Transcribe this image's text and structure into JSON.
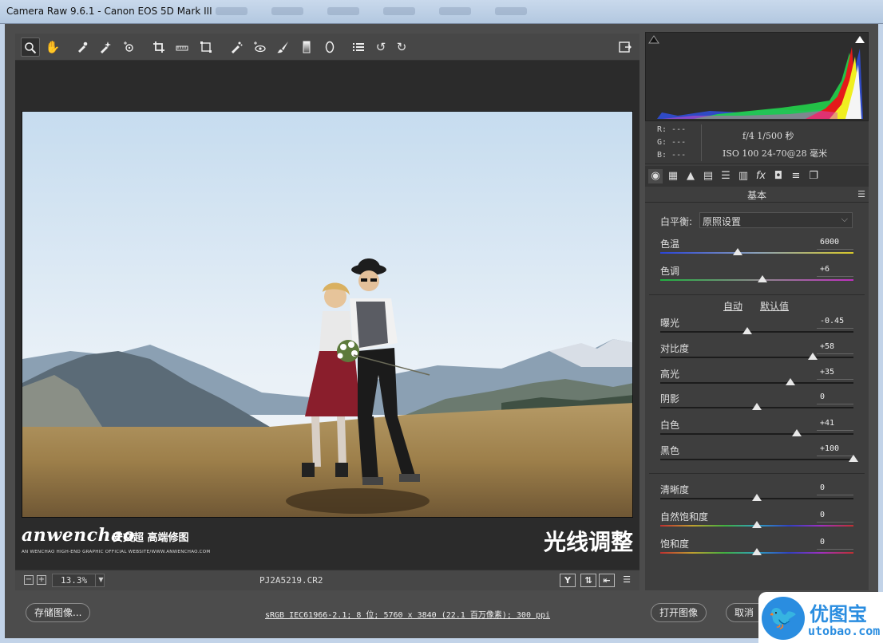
{
  "window": {
    "title": "Camera Raw 9.6.1 -  Canon EOS 5D Mark III"
  },
  "toolbar": {
    "tools": [
      "zoom-icon",
      "hand-icon",
      "white-balance-icon",
      "color-sampler-icon",
      "target-adjust-icon",
      "crop-icon",
      "straighten-icon",
      "transform-icon",
      "spot-removal-icon",
      "red-eye-icon",
      "adjustment-brush-icon",
      "graduated-filter-icon",
      "radial-filter-icon",
      "presets-list-icon",
      "rotate-left-icon",
      "rotate-right-icon"
    ],
    "active_tool": "zoom-icon"
  },
  "canvas": {
    "watermark_logo": "anwenchao",
    "watermark_cn": "安文超 高端修图",
    "watermark_sub": "AN WENCHAO HIGH-END GRAPHIC OFFICIAL WEBSITE/WWW.ANWENCHAO.COM",
    "overlay_title": "光线调整"
  },
  "status": {
    "zoom": "13.3%",
    "filename": "PJ2A5219.CR2",
    "view_icon_label": "Y"
  },
  "readout": {
    "r": "R:  ---",
    "g": "G:  ---",
    "b": "B:  ---",
    "line1": "f/4   1/500 秒",
    "line2": "ISO 100   24-70@28 毫米"
  },
  "panel": {
    "section_title": "基本",
    "white_balance_label": "白平衡:",
    "white_balance_value": "原照设置",
    "auto_label": "自动",
    "default_label": "默认值",
    "sliders": [
      {
        "label": "色温",
        "value": "6000",
        "pos": 0.4,
        "track": "temp"
      },
      {
        "label": "色调",
        "value": "+6",
        "pos": 0.53,
        "track": "tint"
      },
      {
        "label": "曝光",
        "value": "-0.45",
        "pos": 0.45,
        "track": "plain"
      },
      {
        "label": "对比度",
        "value": "+58",
        "pos": 0.79,
        "track": "plain"
      },
      {
        "label": "高光",
        "value": "+35",
        "pos": 0.675,
        "track": "plain"
      },
      {
        "label": "阴影",
        "value": "0",
        "pos": 0.5,
        "track": "plain"
      },
      {
        "label": "白色",
        "value": "+41",
        "pos": 0.705,
        "track": "plain"
      },
      {
        "label": "黑色",
        "value": "+100",
        "pos": 1.0,
        "track": "plain"
      },
      {
        "label": "清晰度",
        "value": "0",
        "pos": 0.5,
        "track": "plain"
      },
      {
        "label": "自然饱和度",
        "value": "0",
        "pos": 0.5,
        "track": "rainbow"
      },
      {
        "label": "饱和度",
        "value": "0",
        "pos": 0.5,
        "track": "rainbow"
      }
    ]
  },
  "bottom": {
    "save_label": "存储图像...",
    "info": "sRGB IEC61966-2.1; 8 位; 5760 x 3840 (22.1 百万像素); 300 ppi",
    "open_label": "打开图像",
    "cancel_label": "取消"
  },
  "brand": {
    "name": "优图宝",
    "url": "utobao.com"
  },
  "colors": {
    "accent": "#2a8de0",
    "panel": "#3e3e3e",
    "canvas": "#2b2b2b"
  }
}
